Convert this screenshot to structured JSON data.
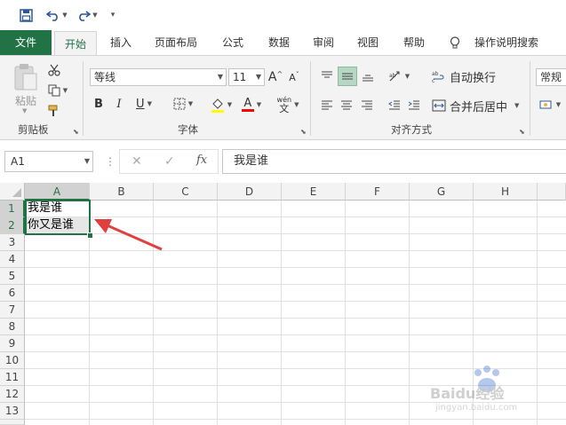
{
  "tabs": {
    "file": "文件",
    "home": "开始",
    "insert": "插入",
    "page_layout": "页面布局",
    "formulas": "公式",
    "data": "数据",
    "review": "审阅",
    "view": "视图",
    "help": "帮助",
    "tell_me": "操作说明搜索"
  },
  "clipboard": {
    "paste": "粘贴",
    "group": "剪贴板"
  },
  "font": {
    "name": "等线",
    "size": "11",
    "bold": "B",
    "italic": "I",
    "underline": "U",
    "grow": "A",
    "shrink": "A",
    "color_letter": "A",
    "phonetic_top": "wén",
    "phonetic_bottom": "文",
    "group": "字体"
  },
  "alignment": {
    "wrap_text": "自动换行",
    "merge_center": "合并后居中",
    "group": "对齐方式"
  },
  "number": {
    "format": "常规"
  },
  "formula_bar": {
    "name_box": "A1",
    "fx": "fx",
    "content": "我是谁"
  },
  "columns": [
    "A",
    "B",
    "C",
    "D",
    "E",
    "F",
    "G",
    "H"
  ],
  "rows": [
    "1",
    "2",
    "3",
    "4",
    "5",
    "6",
    "7",
    "8",
    "9",
    "10",
    "11",
    "12",
    "13"
  ],
  "cells": {
    "A1": "我是谁",
    "A2": "你又是谁"
  },
  "watermark": {
    "brand": "Baidu经验",
    "url": "jingyan.baidu.com"
  },
  "colors": {
    "excel_green": "#217346",
    "arrow_red": "#e04040",
    "highlight_yellow": "#ffff00",
    "font_red": "#ff0000"
  }
}
